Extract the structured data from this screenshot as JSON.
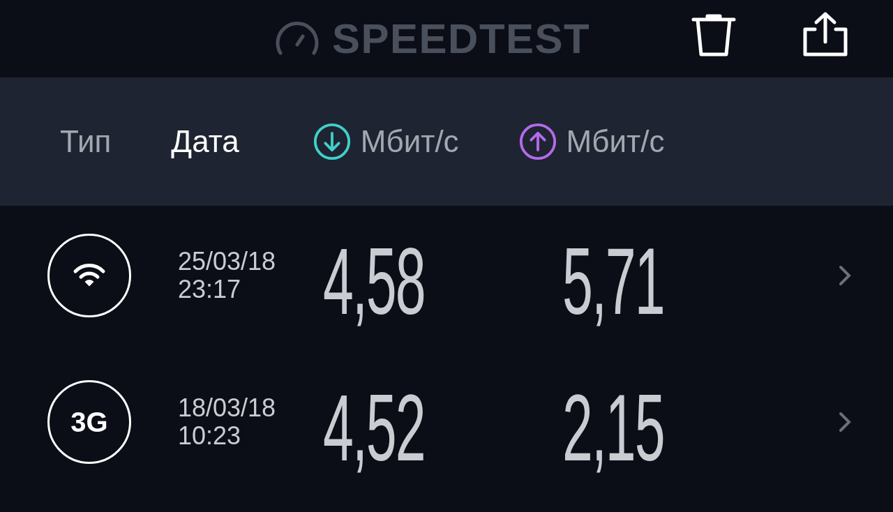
{
  "header": {
    "title": "SPEEDTEST"
  },
  "columns": [
    {
      "label": "Тип",
      "selected": false,
      "kind": "plain"
    },
    {
      "label": "Дата",
      "selected": true,
      "kind": "plain"
    },
    {
      "label": "Мбит/с",
      "selected": false,
      "kind": "download"
    },
    {
      "label": "Мбит/с",
      "selected": false,
      "kind": "upload"
    }
  ],
  "results": [
    {
      "kind": "wifi",
      "date": "25/03/18",
      "time": "23:17",
      "download": "4,58",
      "upload": "5,71"
    },
    {
      "kind": "text",
      "badge": "3G",
      "date": "18/03/18",
      "time": "10:23",
      "download": "4,52",
      "upload": "2,15"
    }
  ]
}
